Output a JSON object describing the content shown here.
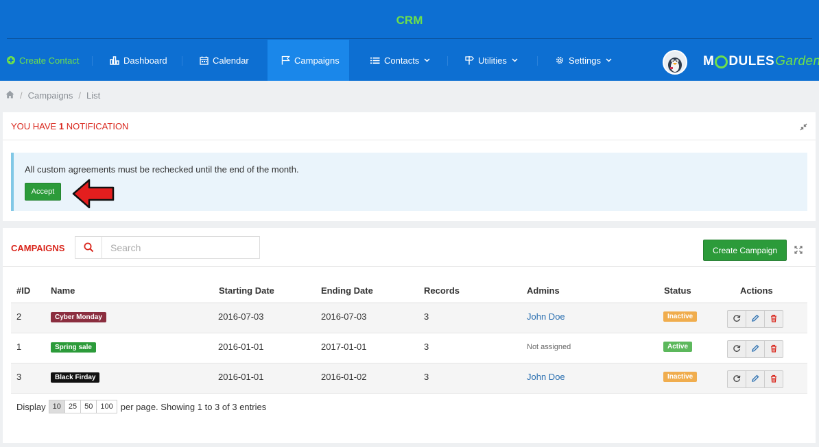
{
  "app_title": "CRM",
  "nav": {
    "create_contact": "Create Contact",
    "dashboard": "Dashboard",
    "calendar": "Calendar",
    "campaigns": "Campaigns",
    "contacts": "Contacts",
    "utilities": "Utilities",
    "settings": "Settings"
  },
  "logo": {
    "part1": "M",
    "part2": "DULES",
    "part3": "Garden"
  },
  "breadcrumb": {
    "item1": "Campaigns",
    "item2": "List"
  },
  "notification": {
    "prefix": "YOU HAVE ",
    "count": "1",
    "suffix": " NOTIFICATION",
    "message": "All custom agreements must be rechecked until the end of the month.",
    "accept_label": "Accept"
  },
  "campaigns": {
    "title": "CAMPAIGNS",
    "search_placeholder": "Search",
    "create_label": "Create Campaign",
    "columns": {
      "id": "#ID",
      "name": "Name",
      "start": "Starting Date",
      "end": "Ending Date",
      "records": "Records",
      "admins": "Admins",
      "status": "Status",
      "actions": "Actions"
    },
    "rows": [
      {
        "id": "2",
        "name": "Cyber Monday",
        "name_color": "#8b2e3f",
        "start": "2016-07-03",
        "end": "2016-07-03",
        "records": "3",
        "admin": "John Doe",
        "status": "Inactive",
        "status_color": "#f0ad4e"
      },
      {
        "id": "1",
        "name": "Spring sale",
        "name_color": "#2c9b3a",
        "start": "2016-01-01",
        "end": "2017-01-01",
        "records": "3",
        "admin": "Not assigned",
        "status": "Active",
        "status_color": "#5cb85c"
      },
      {
        "id": "3",
        "name": "Black Firday",
        "name_color": "#111111",
        "start": "2016-01-01",
        "end": "2016-01-02",
        "records": "3",
        "admin": "John Doe",
        "status": "Inactive",
        "status_color": "#f0ad4e"
      }
    ]
  },
  "footer": {
    "display": "Display",
    "pages": [
      "10",
      "25",
      "50",
      "100"
    ],
    "summary": "per page. Showing 1 to 3 of 3 entries"
  },
  "icons": {
    "nav": [
      "plus-circle-icon",
      "bar-chart-icon",
      "calendar-icon",
      "flag-icon",
      "list-icon",
      "signpost-icon",
      "gear-icon"
    ],
    "actions": [
      "refresh-icon",
      "pencil-icon",
      "trash-icon"
    ]
  },
  "colors": {
    "primary": "#0d6fd2",
    "accent_green": "#6ee04a",
    "button_green": "#2c9b3a",
    "danger": "#d9261c"
  }
}
